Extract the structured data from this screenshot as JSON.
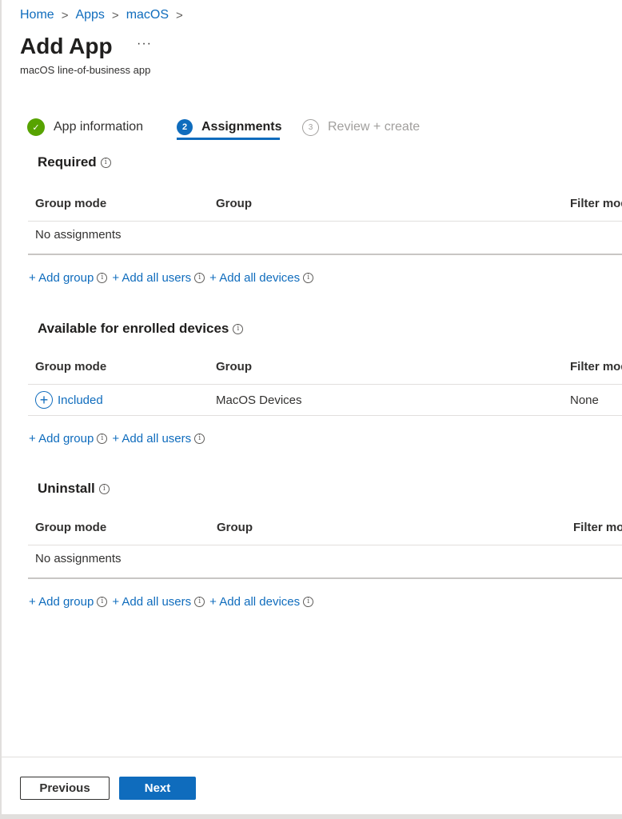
{
  "breadcrumb": {
    "items": [
      "Home",
      "Apps",
      "macOS"
    ]
  },
  "header": {
    "title": "Add App",
    "more": "···",
    "subtitle": "macOS line-of-business app"
  },
  "steps": [
    {
      "number": "✓",
      "label": "App information",
      "state": "complete"
    },
    {
      "number": "2",
      "label": "Assignments",
      "state": "current"
    },
    {
      "number": "3",
      "label": "Review + create",
      "state": "pending"
    }
  ],
  "columns": {
    "group_mode": "Group mode",
    "group": "Group",
    "filter_mode": "Filter mode"
  },
  "required": {
    "title": "Required",
    "empty": "No assignments"
  },
  "available": {
    "title": "Available for enrolled devices",
    "row": {
      "mode": "Included",
      "group": "MacOS Devices",
      "filter": "None"
    }
  },
  "uninstall": {
    "title": "Uninstall",
    "empty": "No assignments"
  },
  "actions": {
    "add_group": "+ Add group",
    "add_all_users": "+ Add all users",
    "add_all_devices": "+ Add all devices"
  },
  "footer": {
    "previous": "Previous",
    "next": "Next"
  },
  "colors": {
    "accent": "#0f6cbd",
    "success": "#57a300"
  }
}
